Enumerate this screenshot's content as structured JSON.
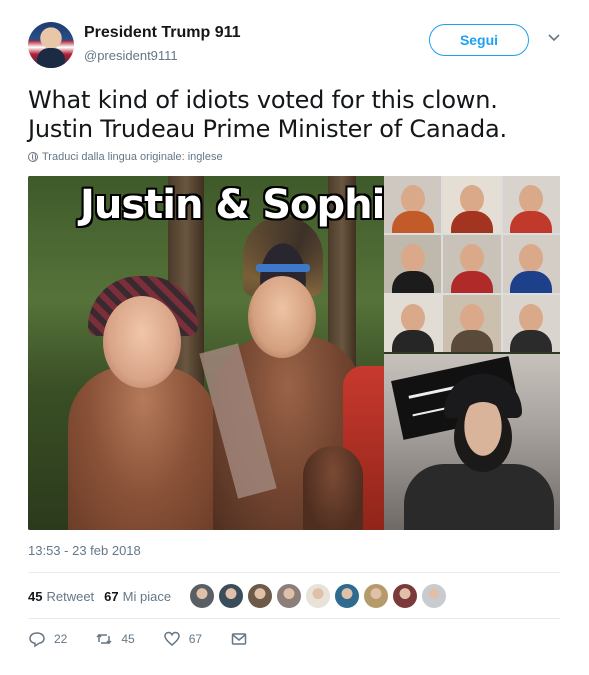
{
  "author": {
    "name": "President Trump 911",
    "handle": "@president9111"
  },
  "follow_button": {
    "label": "Segui"
  },
  "tweet": {
    "lines": [
      "What kind of idiots voted for this clown.",
      "Justin Trudeau Prime Minister of Canada."
    ]
  },
  "translate_note": "Traduci dalla lingua originale: inglese",
  "media": {
    "overlay_text": "Justin & Sophie"
  },
  "timestamp": "13:53 - 23 feb 2018",
  "stats": {
    "retweets_count": "45",
    "retweets_label": "Retweet",
    "likes_count": "67",
    "likes_label": "Mi piace"
  },
  "likers": [
    "#5a5f66",
    "#3b4c5a",
    "#6e5a48",
    "#8a7f7a",
    "#e8e2d8",
    "#2f6b8f",
    "#b59a6a",
    "#7a3a3a",
    "#c7ccd1"
  ],
  "actions": {
    "reply_count": "22",
    "retweet_count": "45",
    "like_count": "67"
  },
  "colors": {
    "accent": "#1da1f2",
    "muted": "#657786",
    "text": "#14171a",
    "divider": "#e6ecf0"
  },
  "icons": [
    "chevron-down-icon",
    "globe-icon",
    "reply-icon",
    "retweet-icon",
    "heart-icon",
    "message-icon"
  ]
}
